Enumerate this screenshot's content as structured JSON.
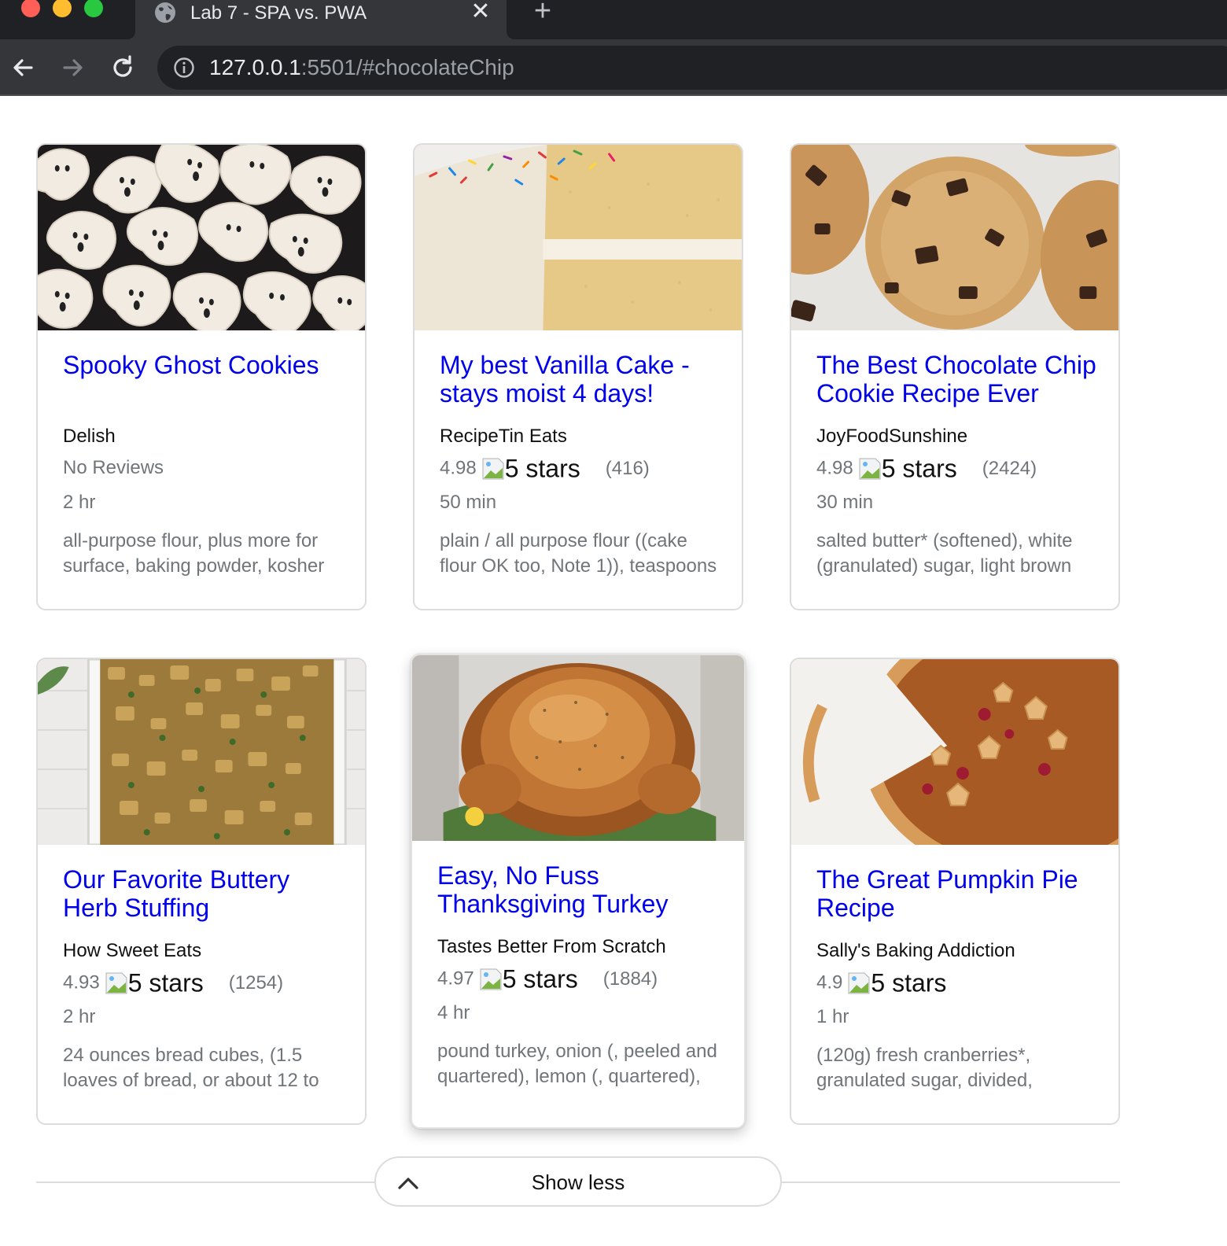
{
  "browser": {
    "tab_title": "Lab 7 - SPA vs. PWA",
    "tab_close": "✕",
    "new_tab": "+",
    "url_host": "127.0.0.1",
    "url_rest": ":5501/#chocolateChip"
  },
  "cards": [
    {
      "title": "Spooky Ghost Cookies",
      "source": "Delish",
      "rating_text": "No Reviews",
      "time": "2 hr",
      "ingredients": "all-purpose flour, plus more for surface, baking powder, kosher",
      "image": "ghost-cookies-image"
    },
    {
      "title": "My best Vanilla Cake - stays moist 4 days!",
      "source": "RecipeTin Eats",
      "rating": "4.98",
      "stars_alt": "5 stars",
      "count": "(416)",
      "time": "50 min",
      "ingredients": "plain / all purpose flour ((cake flour OK too, Note 1)), teaspoons",
      "image": "vanilla-cake-image"
    },
    {
      "title": "The Best Chocolate Chip Cookie Recipe Ever",
      "source": "JoyFoodSunshine",
      "rating": "4.98",
      "stars_alt": "5 stars",
      "count": "(2424)",
      "time": "30 min",
      "ingredients": "salted butter* (softened), white (granulated) sugar, light brown",
      "image": "chocolate-chip-cookie-image"
    },
    {
      "title": "Our Favorite Buttery Herb Stuffing",
      "source": "How Sweet Eats",
      "rating": "4.93",
      "stars_alt": "5 stars",
      "count": "(1254)",
      "time": "2 hr",
      "ingredients": "24 ounces bread cubes, (1.5 loaves of bread, or about 12 to",
      "image": "herb-stuffing-image"
    },
    {
      "title": "Easy, No Fuss Thanksgiving Turkey",
      "source": "Tastes Better From Scratch",
      "rating": "4.97",
      "stars_alt": "5 stars",
      "count": "(1884)",
      "time": "4 hr",
      "ingredients": "pound turkey, onion (, peeled and quartered), lemon (, quartered),",
      "image": "thanksgiving-turkey-image"
    },
    {
      "title": "The Great Pumpkin Pie Recipe",
      "source": "Sally's Baking Addiction",
      "rating": "4.9",
      "stars_alt": "5 stars",
      "count": "",
      "time": "1 hr",
      "ingredients": "(120g) fresh cranberries*, granulated sugar, divided,",
      "image": "pumpkin-pie-image"
    }
  ],
  "show_less": {
    "label": "Show less"
  },
  "colors": {
    "link": "#0000ee",
    "muted": "#70757a",
    "chrome_dark": "#202124",
    "chrome_tab": "#35363a"
  }
}
